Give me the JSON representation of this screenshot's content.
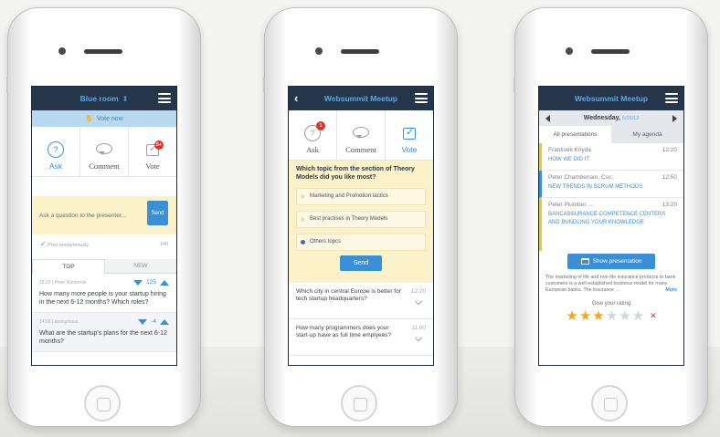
{
  "phone1": {
    "header_title": "Blue room",
    "vote_now": "Vote now",
    "tabs": [
      {
        "label": "Ask"
      },
      {
        "label": "Comment"
      },
      {
        "label": "Vote"
      }
    ],
    "vote_badge": "5+",
    "ask_placeholder": "Ask a question to the presenter...",
    "send": "Send",
    "anon_label": "Post anonymously",
    "char_count": "140",
    "seg": [
      "TOP",
      "NEW"
    ],
    "questions": [
      {
        "meta": "15:22 | Peter Komorník",
        "votes": "125",
        "text": "How many more people is your startup hiring in the next 6-12 months? Which roles?"
      },
      {
        "meta": "14:03 | anonymous",
        "votes": "-4",
        "text": "What are the startup's plans for the next 6-12 months?"
      }
    ]
  },
  "phone2": {
    "header_title": "Websummit Meetup",
    "tabs": [
      {
        "label": "Ask"
      },
      {
        "label": "Comment"
      },
      {
        "label": "Vote"
      }
    ],
    "ask_badge": "1",
    "poll_question": "Which topic from the section of Theory Models did you like most?",
    "options": [
      "Marketing and Promotion tactics",
      "Best practises in Theory Models",
      "Others topcs"
    ],
    "send": "Send",
    "questions": [
      {
        "text": "Which city in central Europe is better for tech startup headquarters?",
        "time": "12:20"
      },
      {
        "text": "How many programmers does your start-up have as full time emplyees?",
        "time": "11:00"
      }
    ]
  },
  "phone3": {
    "header_title": "Websummit Meetup",
    "day": "Wednesday,",
    "date": "5/15/13",
    "tabs": [
      "All presentations",
      "My agenda"
    ],
    "presentations": [
      {
        "speaker": "Frantisek Kriyda",
        "time": "12:20",
        "title": "HOW WE DID IT"
      },
      {
        "speaker": "Peter Chamberlain, Csc.",
        "time": "12:50",
        "title": "NEW TRENDS IN SCRUM METHODS"
      },
      {
        "speaker": "Peter Plumber, ...",
        "time": "13:20",
        "title": "BANCASSURANCE COMPETENCE CENTERS AND BUNDLING YOUR KNOWLEDGE"
      }
    ],
    "show_button": "Show presentation",
    "description": "The marketing of life and non-life insurance products to bank customers is a well established business model for many European banks. The insurance ...",
    "more": "More",
    "rating_label": "Give your rating",
    "rating": 3,
    "rating_max": 6
  },
  "colors": {
    "accent": "#3a8fd6",
    "header": "#25364b",
    "highlight": "#fbf2c9",
    "star": "#f2a81d",
    "badge": "#e0322b"
  }
}
